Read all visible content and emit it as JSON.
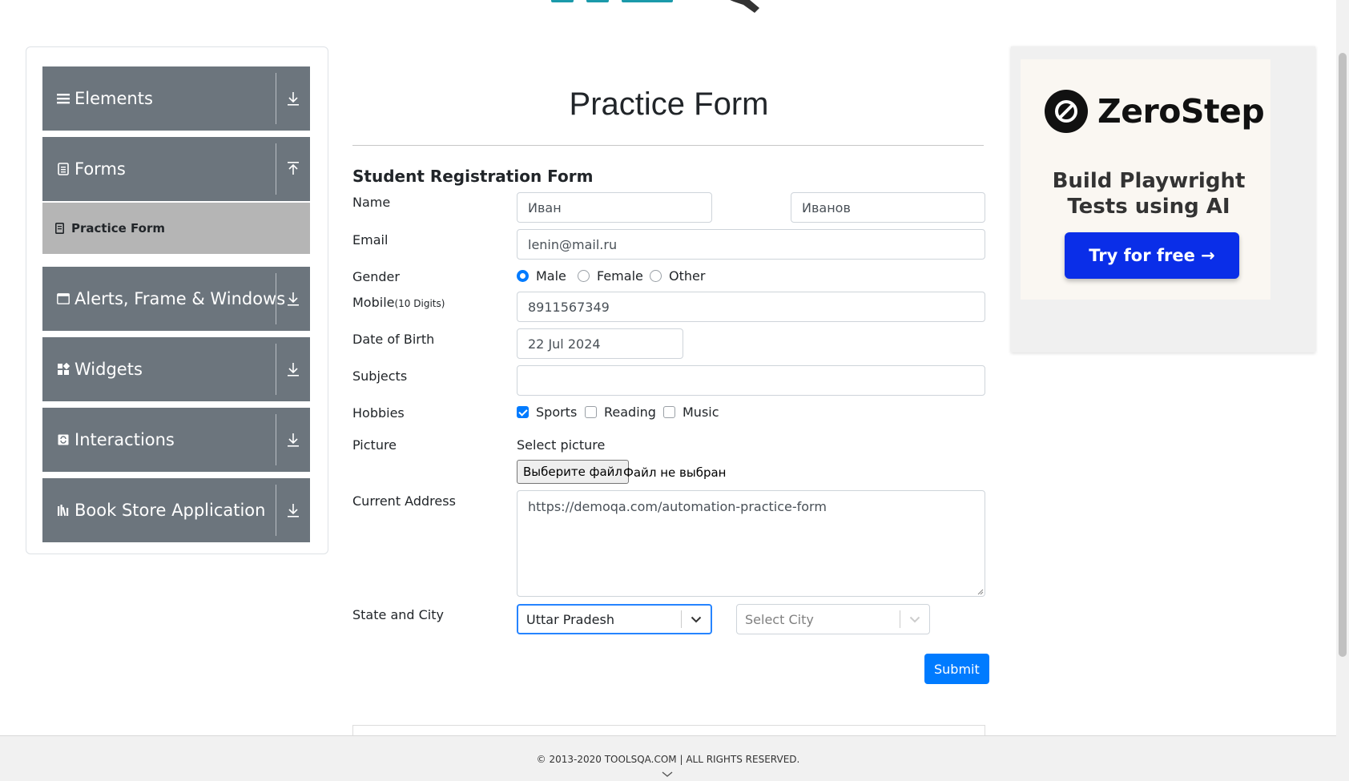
{
  "sidebar": {
    "groups": [
      {
        "label": "Elements",
        "icon": "hamburger-icon"
      },
      {
        "label": "Forms",
        "icon": "document-icon",
        "expanded": true
      },
      {
        "label": "Alerts, Frame & Windows",
        "icon": "window-icon"
      },
      {
        "label": "Widgets",
        "icon": "widgets-icon"
      },
      {
        "label": "Interactions",
        "icon": "interactions-icon"
      },
      {
        "label": "Book Store Application",
        "icon": "books-icon"
      }
    ],
    "active_item": "Practice Form"
  },
  "main": {
    "title": "Practice Form",
    "form_heading": "Student Registration Form",
    "labels": {
      "name": "Name",
      "email": "Email",
      "gender": "Gender",
      "mobile": "Mobile",
      "mobile_hint": "(10 Digits)",
      "dob": "Date of Birth",
      "subjects": "Subjects",
      "hobbies": "Hobbies",
      "picture": "Picture",
      "current_address": "Current Address",
      "state_city": "State and City"
    },
    "first_name": "Иван",
    "last_name": "Иванов",
    "email": "lenin@mail.ru",
    "gender_options": [
      "Male",
      "Female",
      "Other"
    ],
    "gender_selected": "Male",
    "mobile": "8911567349",
    "dob": "22 Jul 2024",
    "subjects": "",
    "hobbies": [
      {
        "label": "Sports",
        "checked": true
      },
      {
        "label": "Reading",
        "checked": false
      },
      {
        "label": "Music",
        "checked": false
      }
    ],
    "picture_label": "Select picture",
    "file_button": "Выберите файл",
    "file_status": "Файл не выбран",
    "current_address": "https://demoqa.com/automation-practice-form",
    "state": "Uttar Pradesh",
    "city_placeholder": "Select City",
    "submit": "Submit"
  },
  "ad": {
    "brand": "ZeroStep",
    "tagline": "Build Playwright Tests using AI",
    "cta": "Try for free →"
  },
  "footer": {
    "text": "© 2013-2020 TOOLSQA.COM | ALL RIGHTS RESERVED."
  },
  "colors": {
    "sidebar_group": "#6c757d",
    "active_item": "#b5b5b5",
    "primary": "#007bff",
    "ad_cta": "#0a2ee8"
  }
}
